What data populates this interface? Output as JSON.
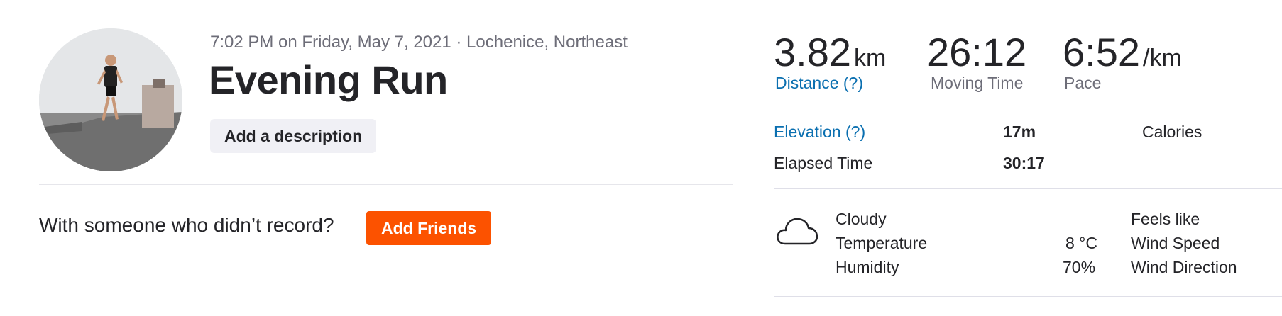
{
  "activity": {
    "datetime": "7:02 PM on Friday, May 7, 2021 · Lochenice, Northeast",
    "title": "Evening Run",
    "description_button": "Add a description",
    "avatar_icon": "runner-photo"
  },
  "friends": {
    "question": "With someone who didn’t record?",
    "button": "Add Friends",
    "button_color": "#fc5200"
  },
  "stats": {
    "distance": {
      "value": "3.82",
      "unit": "km",
      "label": "Distance (?)"
    },
    "moving_time": {
      "value": "26:12",
      "label": "Moving Time"
    },
    "pace": {
      "value": "6:52",
      "unit": "/km",
      "label": "Pace"
    }
  },
  "details": {
    "elevation_label": "Elevation (?)",
    "elevation_value": "17m",
    "calories_label": "Calories",
    "elapsed_label": "Elapsed Time",
    "elapsed_value": "30:17"
  },
  "weather": {
    "icon": "cloud-icon",
    "condition": "Cloudy",
    "temperature_label": "Temperature",
    "temperature_value": "8 °C",
    "humidity_label": "Humidity",
    "humidity_value": "70%",
    "feels_like_label": "Feels like",
    "wind_speed_label": "Wind Speed",
    "wind_direction_label": "Wind Direction"
  },
  "colors": {
    "link": "#0a6fb0",
    "muted": "#6d6d78"
  }
}
